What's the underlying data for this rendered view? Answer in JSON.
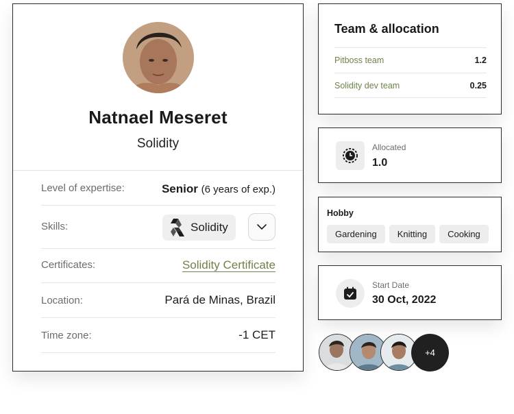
{
  "profile": {
    "name": "Natnael Meseret",
    "role": "Solidity",
    "expertise_label": "Level of expertise:",
    "expertise_level": "Senior",
    "expertise_years": "(6 years of exp.)",
    "skills_label": "Skills:",
    "skill_name": "Solidity",
    "certificates_label": "Certificates:",
    "certificate_link": "Solidity Certificate",
    "location_label": "Location:",
    "location_value": "Pará de Minas, Brazil",
    "timezone_label": "Time zone:",
    "timezone_value": "-1 CET"
  },
  "team": {
    "title": "Team & allocation",
    "rows": [
      {
        "name": "Pitboss team",
        "value": "1.2"
      },
      {
        "name": "Solidity dev team",
        "value": "0.25"
      }
    ]
  },
  "allocation": {
    "label": "Allocated",
    "value": "1.0",
    "icon": "clock-icon"
  },
  "hobby": {
    "title": "Hobby",
    "tags": [
      "Gardening",
      "Knitting",
      "Cooking"
    ]
  },
  "start_date": {
    "label": "Start Date",
    "value": "30 Oct, 2022",
    "icon": "calendar-icon"
  },
  "avatars": {
    "more_count": "+4"
  },
  "colors": {
    "accent_green": "#6e8247",
    "border": "#2a2a2a",
    "chip_bg": "#efefef"
  }
}
